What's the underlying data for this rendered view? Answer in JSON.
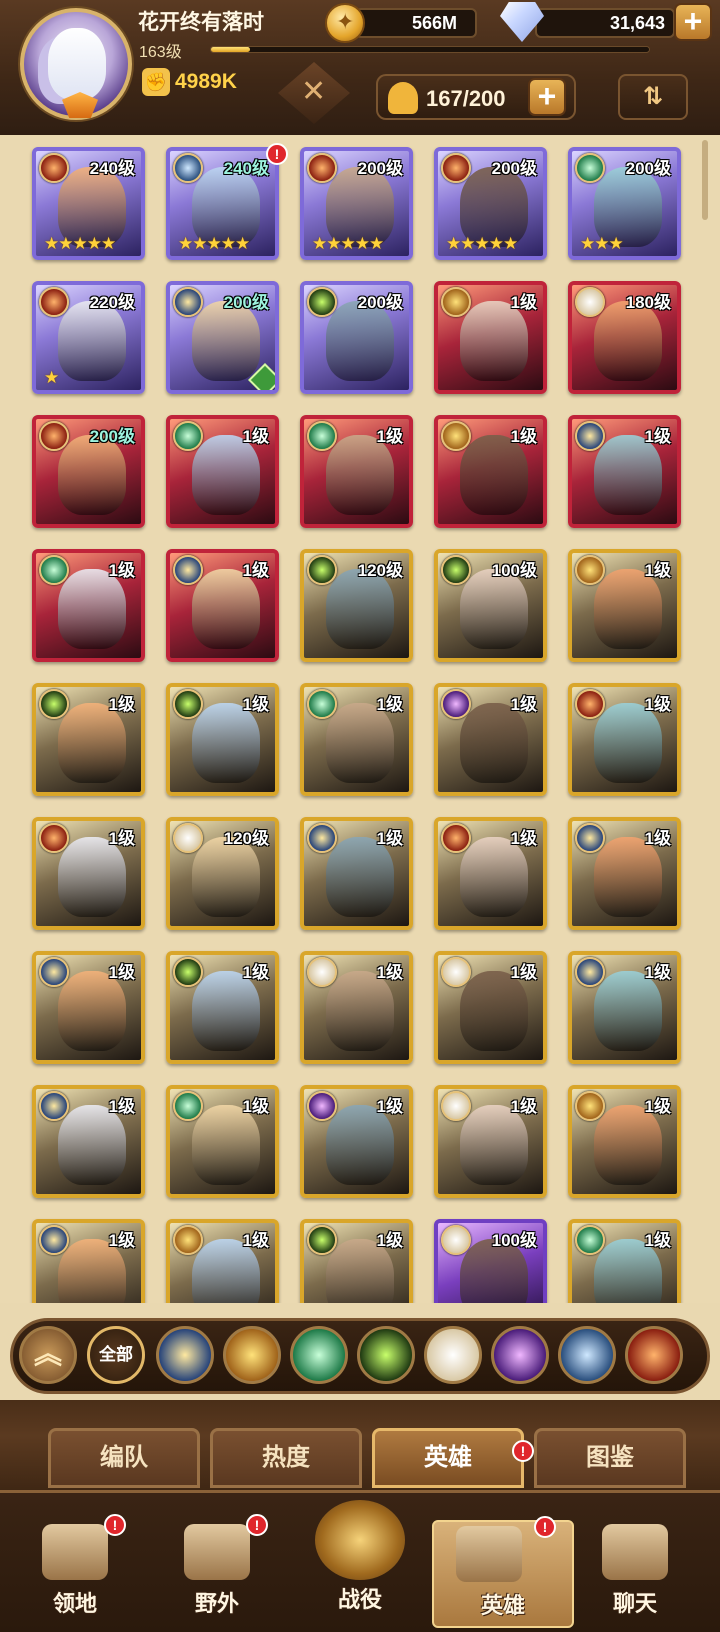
{
  "player": {
    "name": "花开终有落时",
    "level": "163级",
    "xp_progress": 0.09,
    "power": "4989K"
  },
  "currencies": {
    "gold": "566M",
    "diamonds": "31,643"
  },
  "roster": {
    "count": "167/200"
  },
  "heroes": [
    {
      "level": "240级",
      "stars": "★★★★★",
      "faction": "f-mauler",
      "frame": "purple",
      "teal": false,
      "alert": false
    },
    {
      "level": "240级",
      "stars": "★★★★★",
      "faction": "f-draconis",
      "frame": "purple",
      "teal": true,
      "alert": true
    },
    {
      "level": "200级",
      "stars": "★★★★★",
      "faction": "f-mauler",
      "frame": "purple",
      "teal": false,
      "alert": false
    },
    {
      "level": "200级",
      "stars": "★★★★★",
      "faction": "f-mauler",
      "frame": "purple",
      "teal": false,
      "alert": false
    },
    {
      "level": "200级",
      "stars": "★★★",
      "faction": "f-wilder",
      "frame": "purple",
      "teal": false,
      "alert": false
    },
    {
      "level": "220级",
      "stars": "★",
      "faction": "f-mauler",
      "frame": "purple",
      "teal": false,
      "alert": false
    },
    {
      "level": "200级",
      "stars": "",
      "faction": "f-lightbearer",
      "frame": "purple",
      "teal": true,
      "alert": false,
      "hourglass": true
    },
    {
      "level": "200级",
      "stars": "",
      "faction": "f-graveborn",
      "frame": "purple",
      "teal": false,
      "alert": false
    },
    {
      "level": "1级",
      "stars": "",
      "faction": "f-dimensional",
      "frame": "red",
      "teal": false,
      "alert": false
    },
    {
      "level": "180级",
      "stars": "",
      "faction": "f-celestial",
      "frame": "red",
      "teal": false,
      "alert": false
    },
    {
      "level": "200级",
      "stars": "",
      "faction": "f-mauler",
      "frame": "red",
      "teal": true,
      "alert": false
    },
    {
      "level": "1级",
      "stars": "",
      "faction": "f-wilder",
      "frame": "red",
      "teal": false,
      "alert": false
    },
    {
      "level": "1级",
      "stars": "",
      "faction": "f-wilder",
      "frame": "red",
      "teal": false,
      "alert": false
    },
    {
      "level": "1级",
      "stars": "",
      "faction": "f-dimensional",
      "frame": "red",
      "teal": false,
      "alert": false
    },
    {
      "level": "1级",
      "stars": "",
      "faction": "f-lightbearer",
      "frame": "red",
      "teal": false,
      "alert": false
    },
    {
      "level": "1级",
      "stars": "",
      "faction": "f-wilder",
      "frame": "red",
      "teal": false,
      "alert": false
    },
    {
      "level": "1级",
      "stars": "",
      "faction": "f-lightbearer",
      "frame": "red",
      "teal": false,
      "alert": false
    },
    {
      "level": "120级",
      "stars": "",
      "faction": "f-graveborn",
      "frame": "gold",
      "teal": false,
      "alert": false
    },
    {
      "level": "100级",
      "stars": "",
      "faction": "f-graveborn",
      "frame": "gold",
      "teal": false,
      "alert": false
    },
    {
      "level": "1级",
      "stars": "",
      "faction": "f-dimensional",
      "frame": "gold",
      "teal": false,
      "alert": false
    },
    {
      "level": "1级",
      "stars": "",
      "faction": "f-graveborn",
      "frame": "gold",
      "teal": false,
      "alert": false
    },
    {
      "level": "1级",
      "stars": "",
      "faction": "f-graveborn",
      "frame": "gold",
      "teal": false,
      "alert": false
    },
    {
      "level": "1级",
      "stars": "",
      "faction": "f-wilder",
      "frame": "gold",
      "teal": false,
      "alert": false
    },
    {
      "level": "1级",
      "stars": "",
      "faction": "f-hypogean",
      "frame": "gold",
      "teal": false,
      "alert": false
    },
    {
      "level": "1级",
      "stars": "",
      "faction": "f-mauler",
      "frame": "gold",
      "teal": false,
      "alert": false
    },
    {
      "level": "1级",
      "stars": "",
      "faction": "f-mauler",
      "frame": "gold",
      "teal": false,
      "alert": false
    },
    {
      "level": "120级",
      "stars": "",
      "faction": "f-celestial",
      "frame": "gold",
      "teal": false,
      "alert": false
    },
    {
      "level": "1级",
      "stars": "",
      "faction": "f-lightbearer",
      "frame": "gold",
      "teal": false,
      "alert": false
    },
    {
      "level": "1级",
      "stars": "",
      "faction": "f-mauler",
      "frame": "gold",
      "teal": false,
      "alert": false
    },
    {
      "level": "1级",
      "stars": "",
      "faction": "f-lightbearer",
      "frame": "gold",
      "teal": false,
      "alert": false
    },
    {
      "level": "1级",
      "stars": "",
      "faction": "f-lightbearer",
      "frame": "gold",
      "teal": false,
      "alert": false
    },
    {
      "level": "1级",
      "stars": "",
      "faction": "f-graveborn",
      "frame": "gold",
      "teal": false,
      "alert": false
    },
    {
      "level": "1级",
      "stars": "",
      "faction": "f-celestial",
      "frame": "gold",
      "teal": false,
      "alert": false
    },
    {
      "level": "1级",
      "stars": "",
      "faction": "f-celestial",
      "frame": "gold",
      "teal": false,
      "alert": false
    },
    {
      "level": "1级",
      "stars": "",
      "faction": "f-lightbearer",
      "frame": "gold",
      "teal": false,
      "alert": false
    },
    {
      "level": "1级",
      "stars": "",
      "faction": "f-lightbearer",
      "frame": "gold",
      "teal": false,
      "alert": false
    },
    {
      "level": "1级",
      "stars": "",
      "faction": "f-wilder",
      "frame": "gold",
      "teal": false,
      "alert": false
    },
    {
      "level": "1级",
      "stars": "",
      "faction": "f-hypogean",
      "frame": "gold",
      "teal": false,
      "alert": false
    },
    {
      "level": "1级",
      "stars": "",
      "faction": "f-celestial",
      "frame": "gold",
      "teal": false,
      "alert": false
    },
    {
      "level": "1级",
      "stars": "",
      "faction": "f-dimensional",
      "frame": "gold",
      "teal": false,
      "alert": false
    },
    {
      "level": "1级",
      "stars": "",
      "faction": "f-lightbearer",
      "frame": "gold",
      "teal": false,
      "alert": false
    },
    {
      "level": "1级",
      "stars": "",
      "faction": "f-dimensional",
      "frame": "gold",
      "teal": false,
      "alert": false
    },
    {
      "level": "1级",
      "stars": "",
      "faction": "f-graveborn",
      "frame": "gold",
      "teal": false,
      "alert": false
    },
    {
      "level": "100级",
      "stars": "",
      "faction": "f-celestial",
      "frame": "violet",
      "teal": false,
      "alert": false
    },
    {
      "level": "1级",
      "stars": "",
      "faction": "f-wilder",
      "frame": "gold",
      "teal": false,
      "alert": false
    }
  ],
  "filters": {
    "all_label": "全部",
    "factions": [
      "lightbearer-icon",
      "dimensional-icon",
      "wilder-icon",
      "graveborn-icon",
      "celestial-icon",
      "hypogean-icon",
      "draconis-icon",
      "mauler-icon"
    ]
  },
  "tabs": [
    {
      "label": "编队",
      "active": false,
      "alert": false
    },
    {
      "label": "热度",
      "active": false,
      "alert": false
    },
    {
      "label": "英雄",
      "active": true,
      "alert": true
    },
    {
      "label": "图鉴",
      "active": false,
      "alert": false
    }
  ],
  "nav": [
    {
      "label": "领地",
      "icon": "castle-icon",
      "alert": true,
      "active": false
    },
    {
      "label": "野外",
      "icon": "scroll-map-icon",
      "alert": true,
      "active": false
    },
    {
      "label": "战役",
      "icon": "battle-emblem-icon",
      "alert": false,
      "active": false
    },
    {
      "label": "英雄",
      "icon": "helmet-icon",
      "alert": true,
      "active": true
    },
    {
      "label": "聊天",
      "icon": "chat-icon",
      "alert": false,
      "active": false
    }
  ],
  "colors": {
    "accent_gold": "#d9a62a",
    "alert_red": "#e0262c",
    "background": "#e9d8b0"
  }
}
